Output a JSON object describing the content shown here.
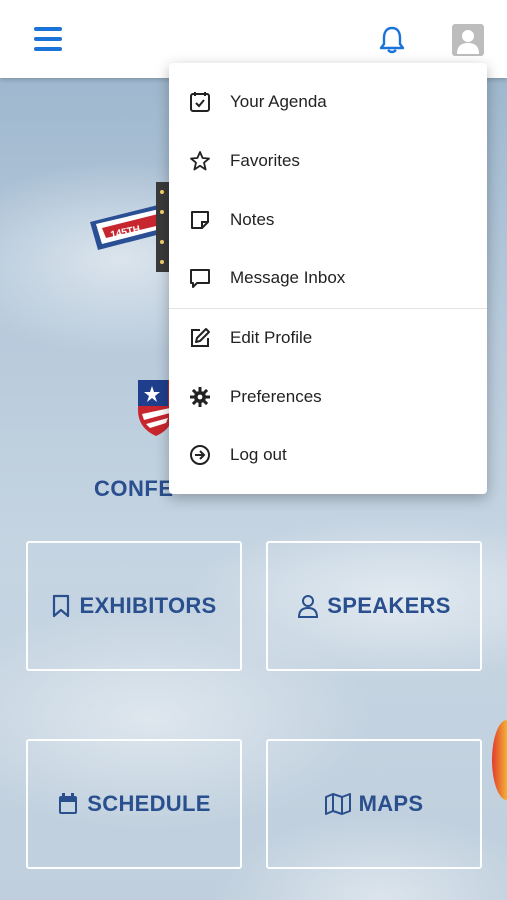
{
  "topbar": {
    "menu_icon": "hamburger-icon",
    "notification_icon": "bell-icon",
    "profile_icon": "avatar-icon",
    "accent": "#1a73d9"
  },
  "dropdown": {
    "items": [
      {
        "label": "Your Agenda",
        "icon": "calendar-check-icon"
      },
      {
        "label": "Favorites",
        "icon": "star-icon"
      },
      {
        "label": "Notes",
        "icon": "note-icon"
      },
      {
        "label": "Message Inbox",
        "icon": "chat-icon"
      },
      {
        "label": "Edit Profile",
        "icon": "edit-icon"
      },
      {
        "label": "Preferences",
        "icon": "gear-icon"
      },
      {
        "label": "Log out",
        "icon": "logout-icon"
      }
    ]
  },
  "banner": {
    "logo_text": "145TH",
    "partial_heading": "CONFE"
  },
  "tiles": [
    {
      "label": "EXHIBITORS",
      "icon": "bookmark-icon"
    },
    {
      "label": "SPEAKERS",
      "icon": "person-icon"
    },
    {
      "label": "SCHEDULE",
      "icon": "calendar-icon"
    },
    {
      "label": "MAPS",
      "icon": "map-icon"
    }
  ],
  "colors": {
    "tile_text": "#2a4f8e",
    "menu_text": "#222222"
  }
}
